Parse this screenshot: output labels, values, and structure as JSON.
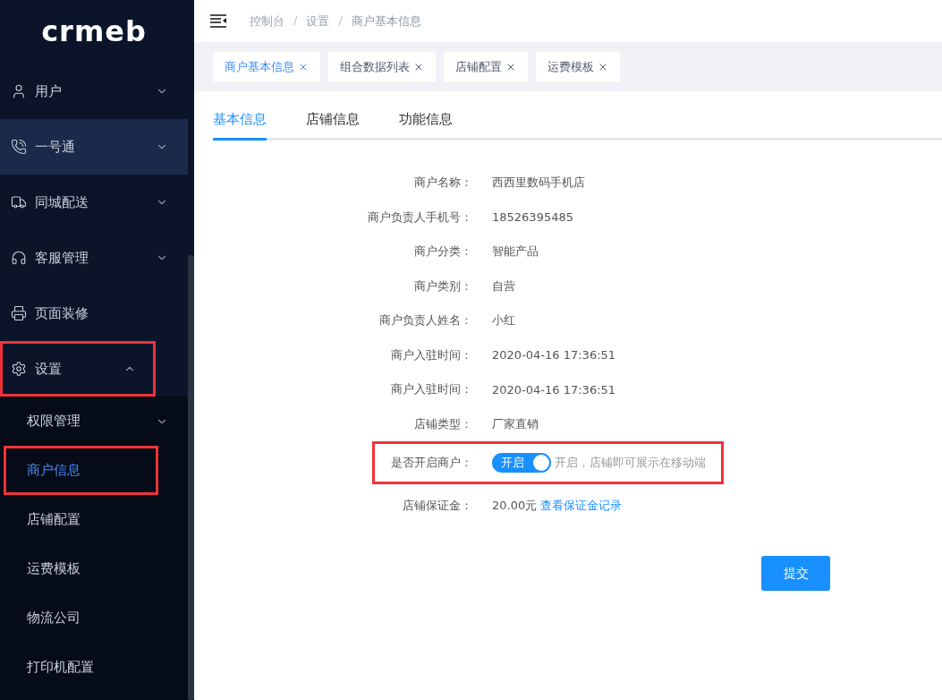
{
  "sidebar": {
    "logo": "crmeb",
    "items": [
      {
        "label": "用户",
        "expanded": false,
        "hovered": false,
        "highlighted": false
      },
      {
        "label": "一号通",
        "expanded": false,
        "hovered": true,
        "highlighted": false
      },
      {
        "label": "同城配送",
        "expanded": false,
        "hovered": false,
        "highlighted": false
      },
      {
        "label": "客服管理",
        "expanded": false,
        "hovered": false,
        "highlighted": false
      },
      {
        "label": "页面装修",
        "highlighted": false,
        "hovered": false
      },
      {
        "label": "设置",
        "expanded": true,
        "hovered": false,
        "highlighted": true,
        "children": [
          {
            "label": "权限管理",
            "expanded": false,
            "selected": false,
            "highlighted": false
          },
          {
            "label": "商户信息",
            "selected": true,
            "highlighted": true
          },
          {
            "label": "店铺配置",
            "selected": false,
            "highlighted": false
          },
          {
            "label": "运费模板",
            "selected": false,
            "highlighted": false
          },
          {
            "label": "物流公司",
            "selected": false,
            "highlighted": false
          },
          {
            "label": "打印机配置",
            "selected": false,
            "highlighted": false
          }
        ]
      }
    ]
  },
  "breadcrumb": [
    {
      "kind": "crumb",
      "text": "控制台"
    },
    {
      "kind": "separator",
      "text": "/"
    },
    {
      "kind": "crumb",
      "text": "设置"
    },
    {
      "kind": "separator",
      "text": "/"
    },
    {
      "kind": "current",
      "text": "商户基本信息"
    }
  ],
  "open_tabs": [
    {
      "label": "商户基本信息",
      "selected": true
    },
    {
      "label": "组合数据列表",
      "selected": false
    },
    {
      "label": "店铺配置",
      "selected": false
    },
    {
      "label": "运费模板",
      "selected": false
    }
  ],
  "tabs": [
    {
      "label": "基本信息",
      "selected": true
    },
    {
      "label": "店铺信息",
      "selected": false
    },
    {
      "label": "功能信息",
      "selected": false
    }
  ],
  "form": [
    {
      "kind": "text",
      "label": "商户名称：",
      "value": "西西里数码手机店"
    },
    {
      "kind": "text",
      "label": "商户负责人手机号：",
      "value": "18526395485"
    },
    {
      "kind": "text",
      "label": "商户分类：",
      "value": "智能产品"
    },
    {
      "kind": "text",
      "label": "商户类别：",
      "value": "自营"
    },
    {
      "kind": "text",
      "label": "商户负责人姓名：",
      "value": "小红"
    },
    {
      "kind": "text",
      "label": "商户入驻时间：",
      "value": "2020-04-16 17:36:51"
    },
    {
      "kind": "text",
      "label": "商户入驻时间：",
      "value": "2020-04-16 17:36:51"
    },
    {
      "kind": "text",
      "label": "店铺类型：",
      "value": "厂家直销"
    },
    {
      "kind": "switch",
      "label": "是否开启商户：",
      "on": true,
      "switch_text": "开启",
      "hint": "开启，店铺即可展示在移动端",
      "highlighted": true
    },
    {
      "kind": "link",
      "label": "店铺保证金：",
      "value": "20.00元",
      "link": "查看保证金记录"
    }
  ],
  "submit": "提交"
}
